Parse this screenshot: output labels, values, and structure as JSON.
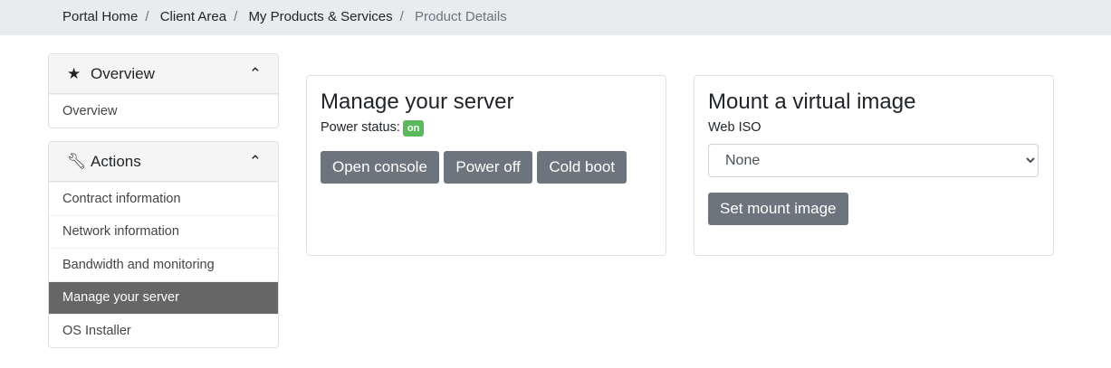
{
  "breadcrumb": [
    "Portal Home",
    "Client Area",
    "My Products & Services",
    "Product Details"
  ],
  "sidebar": {
    "overview": {
      "title": "Overview",
      "items": [
        "Overview"
      ]
    },
    "actions": {
      "title": "Actions",
      "items": [
        "Contract information",
        "Network information",
        "Bandwidth and monitoring",
        "Manage your server",
        "OS Installer"
      ],
      "active": "Manage your server"
    }
  },
  "manage": {
    "title": "Manage your server",
    "power_label": "Power status:",
    "power_badge": "on",
    "buttons": [
      "Open console",
      "Power off",
      "Cold boot"
    ]
  },
  "mount": {
    "title": "Mount a virtual image",
    "field_label": "Web ISO",
    "selected": "None",
    "button": "Set mount image"
  },
  "colors": {
    "badge": "#5cb85c",
    "button": "#6c757d",
    "active": "#666666"
  }
}
